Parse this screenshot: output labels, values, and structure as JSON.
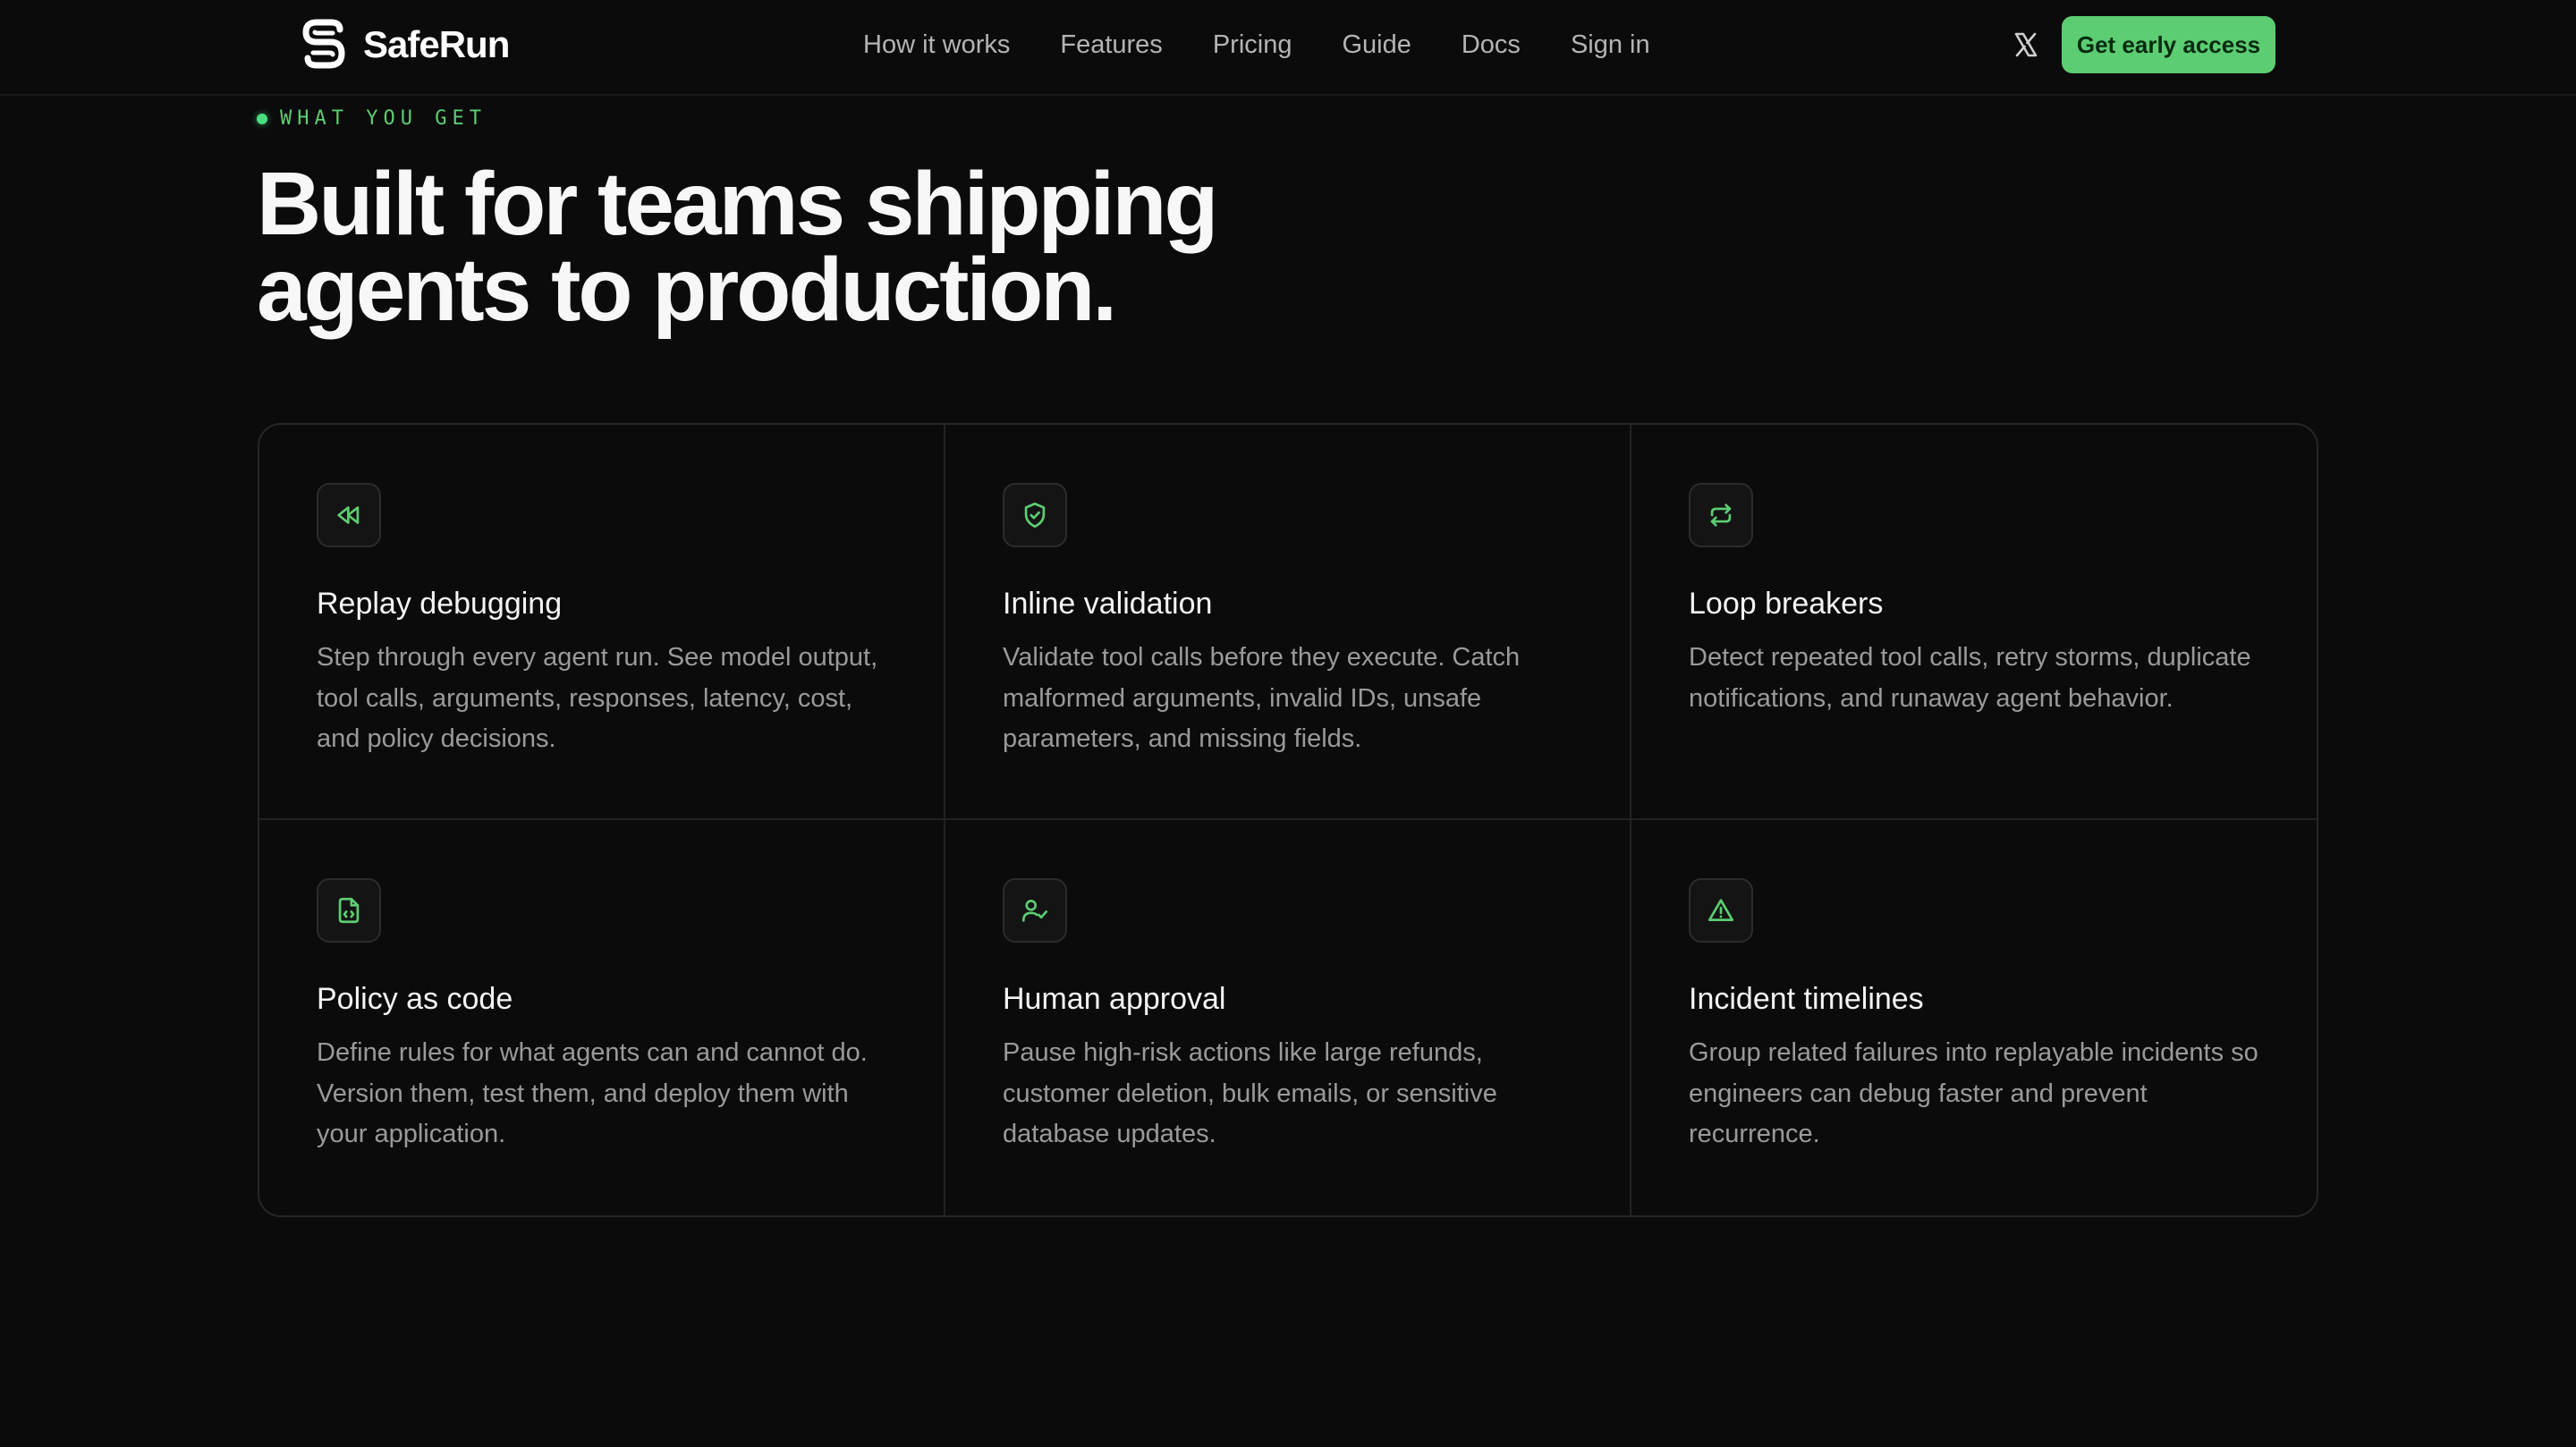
{
  "header": {
    "brand": "SafeRun",
    "nav": [
      "How it works",
      "Features",
      "Pricing",
      "Guide",
      "Docs",
      "Sign in"
    ],
    "social_icon": "x-twitter-icon",
    "cta_label": "Get early access"
  },
  "section": {
    "eyebrow": "WHAT YOU GET",
    "headline_line1": "Built for teams shipping",
    "headline_line2": "agents to production."
  },
  "features": [
    {
      "icon": "replay-rewind-icon",
      "title": "Replay debugging",
      "description": "Step through every agent run. See model output, tool calls, arguments, responses, latency, cost, and policy decisions."
    },
    {
      "icon": "shield-check-icon",
      "title": "Inline validation",
      "description": "Validate tool calls before they execute. Catch malformed arguments, invalid IDs, unsafe parameters, and missing fields."
    },
    {
      "icon": "repeat-arrows-icon",
      "title": "Loop breakers",
      "description": "Detect repeated tool calls, retry storms, duplicate notifications, and runaway agent behavior."
    },
    {
      "icon": "file-code-icon",
      "title": "Policy as code",
      "description": "Define rules for what agents can and cannot do. Version them, test them, and deploy them with your application."
    },
    {
      "icon": "user-check-icon",
      "title": "Human approval",
      "description": "Pause high-risk actions like large refunds, customer deletion, bulk emails, or sensitive database updates."
    },
    {
      "icon": "alert-triangle-icon",
      "title": "Incident timelines",
      "description": "Group related failures into replayable incidents so engineers can debug faster and prevent recurrence."
    }
  ],
  "colors": {
    "background": "#0b0b0b",
    "accent": "#5ccd72",
    "border": "#262626",
    "muted_text": "#9a9a9a"
  }
}
